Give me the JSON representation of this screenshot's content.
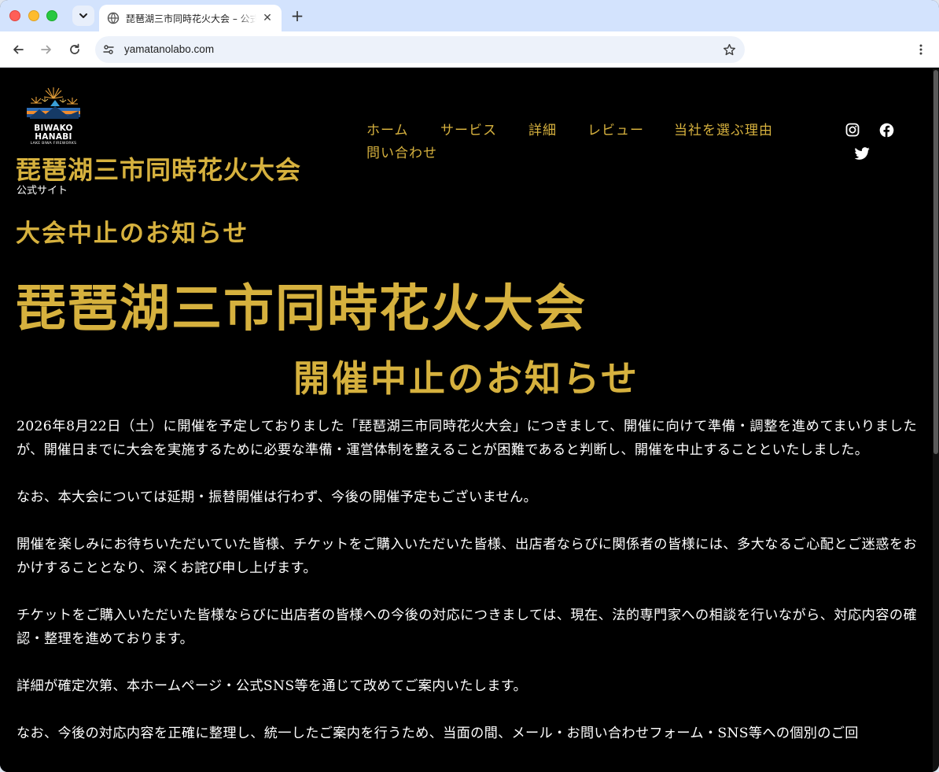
{
  "browser": {
    "tab_title": "琵琶湖三市同時花火大会 – 公式サイト",
    "tab_close": "✕",
    "new_tab": "+",
    "url": "yamatanolabo.com"
  },
  "site": {
    "logo_line1": "BIWAKO",
    "logo_line2": "HANABI",
    "logo_line3": "LAKE BIWA FIREWORKS",
    "title": "琵琶湖三市同時花火大会",
    "subtitle": "公式サイト",
    "nav": [
      "ホーム",
      "サービス",
      "詳細",
      "レビュー",
      "当社を選ぶ理由",
      "問い合わせ"
    ],
    "social": [
      "instagram-icon",
      "facebook-icon",
      "twitter-icon"
    ]
  },
  "content": {
    "notice_small": "大会中止のお知らせ",
    "heading_big": "琵琶湖三市同時花火大会",
    "heading_mid": "開催中止のお知らせ",
    "paragraphs": [
      "2026年8月22日（土）に開催を予定しておりました「琵琶湖三市同時花火大会」につきまして、開催に向けて準備・調整を進めてまいりましたが、開催日までに大会を実施するために必要な準備・運営体制を整えることが困難であると判断し、開催を中止することといたしました。",
      "なお、本大会については延期・振替開催は行わず、今後の開催予定もございません。",
      "開催を楽しみにお待ちいただいていた皆様、チケットをご購入いただいた皆様、出店者ならびに関係者の皆様には、多大なるご心配とご迷惑をおかけすることとなり、深くお詫び申し上げます。",
      "チケットをご購入いただいた皆様ならびに出店者の皆様への今後の対応につきましては、現在、法的専門家への相談を行いながら、対応内容の確認・整理を進めております。",
      "詳細が確定次第、本ホームページ・公式SNS等を通じて改めてご案内いたします。",
      "なお、今後の対応内容を正確に整理し、統一したご案内を行うため、当面の間、メール・お問い合わせフォーム・SNS等への個別のご回"
    ]
  },
  "colors": {
    "accent_gold": "#d6b13e",
    "page_bg": "#000000",
    "tab_strip": "#d3e3fd"
  }
}
